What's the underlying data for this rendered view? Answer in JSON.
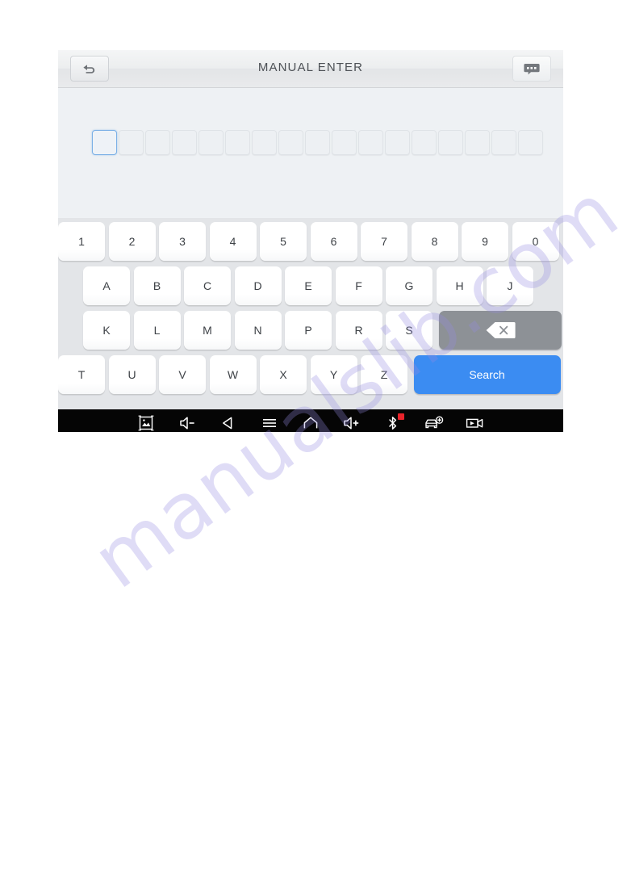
{
  "header": {
    "title": "MANUAL ENTER",
    "back_icon": "back-arrow-icon",
    "chat_icon": "chat-bubble-icon"
  },
  "input_area": {
    "cell_count": 17,
    "active_cell_index": 0,
    "cell_values": [
      "",
      "",
      "",
      "",
      "",
      "",
      "",
      "",
      "",
      "",
      "",
      "",
      "",
      "",
      "",
      "",
      ""
    ],
    "clear_icon": "clear-circle-x-icon"
  },
  "keyboard": {
    "rows": [
      {
        "indent": false,
        "keys": [
          "1",
          "2",
          "3",
          "4",
          "5",
          "6",
          "7",
          "8",
          "9",
          "0"
        ]
      },
      {
        "indent": true,
        "keys": [
          "A",
          "B",
          "C",
          "D",
          "E",
          "F",
          "G",
          "H",
          "J"
        ]
      },
      {
        "indent": true,
        "keys": [
          "K",
          "L",
          "M",
          "N",
          "P",
          "R",
          "S"
        ]
      },
      {
        "indent": false,
        "keys": [
          "T",
          "U",
          "V",
          "W",
          "X",
          "Y",
          "Z"
        ]
      }
    ],
    "backspace_label": "",
    "backspace_icon": "backspace-delete-icon",
    "search_label": "Search",
    "search_color": "#3b8cf2",
    "backspace_color": "#8d9196"
  },
  "navbar": {
    "items": [
      {
        "icon": "screenshot-icon",
        "badge": false
      },
      {
        "icon": "volume-down-icon",
        "badge": false
      },
      {
        "icon": "back-triangle-icon",
        "badge": false
      },
      {
        "icon": "menu-hamburger-icon",
        "badge": false
      },
      {
        "icon": "home-icon",
        "badge": false
      },
      {
        "icon": "volume-up-icon",
        "badge": false
      },
      {
        "icon": "bluetooth-icon",
        "badge": true
      },
      {
        "icon": "vehicle-add-icon",
        "badge": false
      },
      {
        "icon": "video-record-icon",
        "badge": false
      }
    ]
  },
  "watermark": {
    "text": "manualslib.com",
    "color": "#968ce1"
  }
}
